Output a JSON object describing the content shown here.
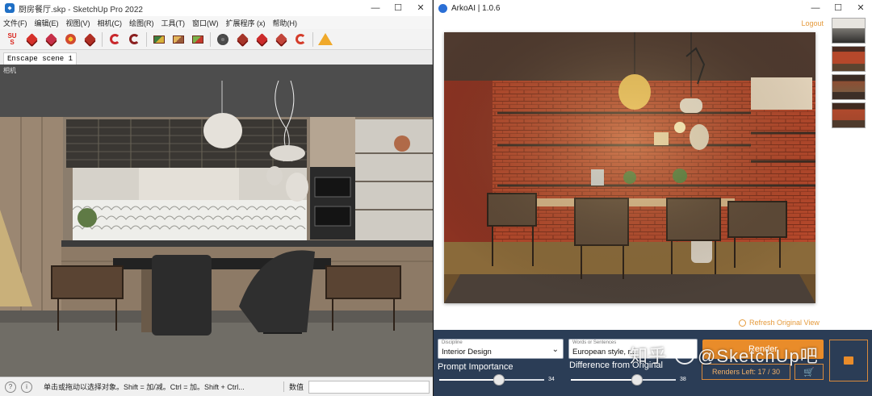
{
  "sketchup": {
    "title": "厨房餐厅.skp - SketchUp Pro 2022",
    "window_controls": [
      "—",
      "☐",
      "✕"
    ],
    "menus": [
      "文件(F)",
      "编辑(E)",
      "视图(V)",
      "相机(C)",
      "绘图(R)",
      "工具(T)",
      "窗口(W)",
      "扩展程序 (x)",
      "帮助(H)"
    ],
    "toolbar_logo": "SU\nS",
    "scene_tab": "Enscape scene 1",
    "viewport_label": "相机",
    "status_message": "单击或拖动以选择对象。Shift = 加/减。Ctrl = 加。Shift + Ctrl...",
    "status_value_label": "数值"
  },
  "arko": {
    "title": "ArkoAI | 1.0.6",
    "window_controls": [
      "—",
      "☐",
      "✕"
    ],
    "logout": "Logout",
    "refresh": "Refresh Original View",
    "discipline": {
      "label": "Discipline",
      "value": "Interior Design"
    },
    "words": {
      "label": "Words or Sentences",
      "value": "European style, r..."
    },
    "prompt_importance": {
      "label": "Prompt Importance",
      "value": 34,
      "max": 60
    },
    "difference": {
      "label": "Difference from Original",
      "value": 38,
      "max": 60
    },
    "render_button": "Render",
    "renders_left": "Renders Left: 17 / 30",
    "cart_icon": "cart-icon"
  },
  "watermark": {
    "left": "知乎",
    "right": "@SketchUp吧"
  }
}
